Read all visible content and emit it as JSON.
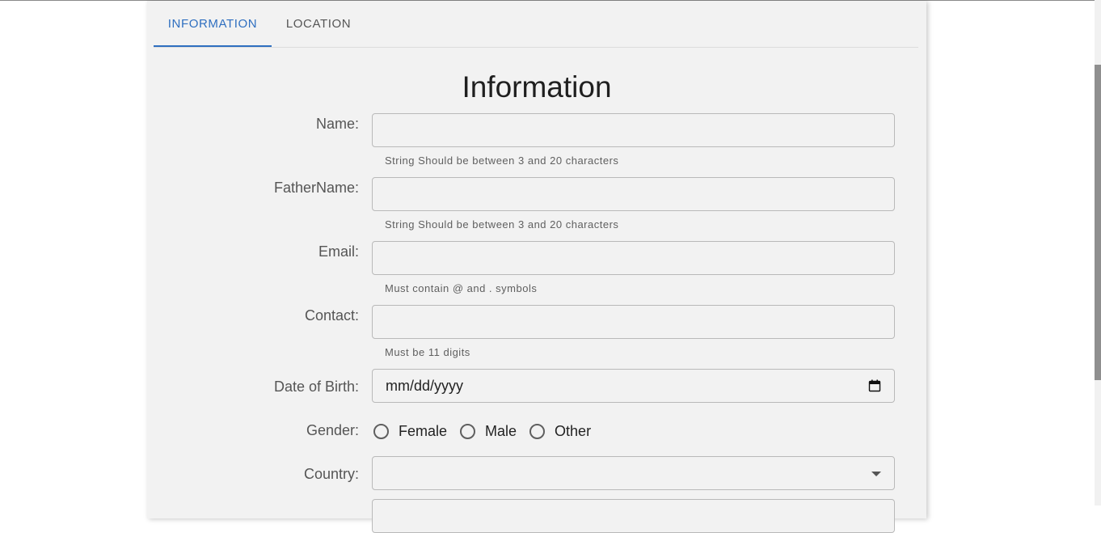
{
  "tabs": [
    {
      "label": "INFORMATION",
      "active": true
    },
    {
      "label": "LOCATION",
      "active": false
    }
  ],
  "form": {
    "title": "Information",
    "name": {
      "label": "Name:",
      "value": "",
      "helper": "String Should be between 3 and 20 characters"
    },
    "father_name": {
      "label": "FatherName:",
      "value": "",
      "helper": "String Should be between 3 and 20 characters"
    },
    "email": {
      "label": "Email:",
      "value": "",
      "helper": "Must contain @ and . symbols"
    },
    "contact": {
      "label": "Contact:",
      "value": "",
      "helper": "Must be 11 digits"
    },
    "dob": {
      "label": "Date of Birth:",
      "placeholder": "mm/dd/yyyy"
    },
    "gender": {
      "label": "Gender:",
      "options": [
        "Female",
        "Male",
        "Other"
      ]
    },
    "country": {
      "label": "Country:",
      "value": ""
    }
  },
  "colors": {
    "accent": "#2f6fc0",
    "card_bg": "#f2f2f2"
  }
}
